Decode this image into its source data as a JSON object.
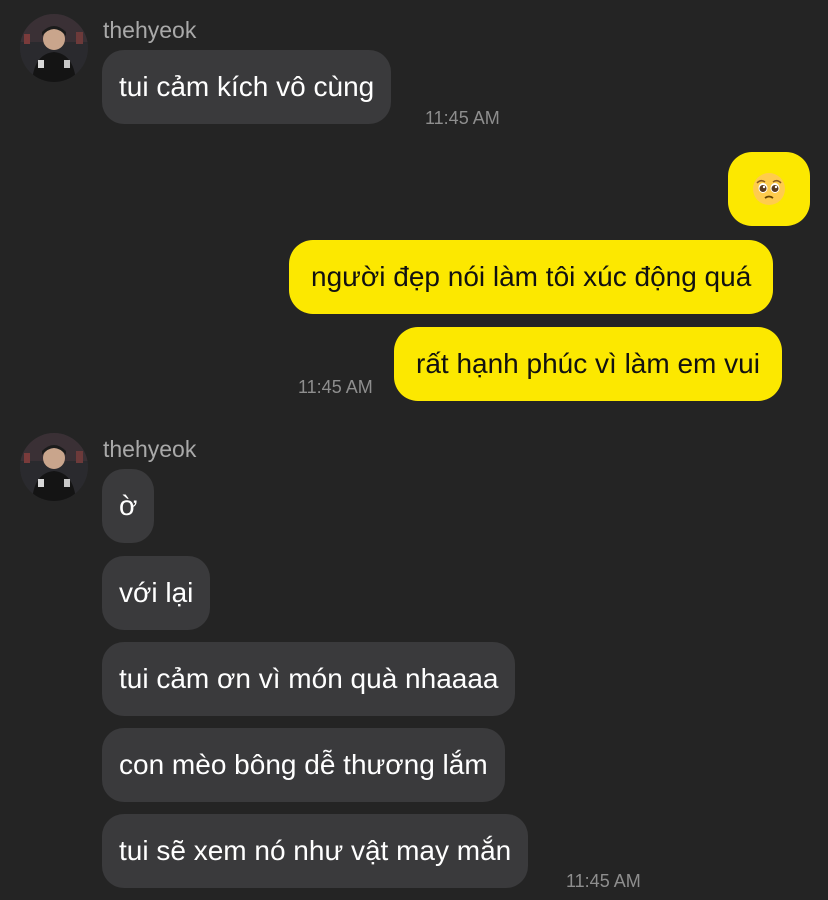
{
  "colors": {
    "background": "#242424",
    "incoming_bubble": "#3a3a3c",
    "outgoing_bubble": "#fce800",
    "timestamp": "#8e8e8e",
    "username": "#a9a9a9"
  },
  "chat": {
    "groups": [
      {
        "sender": "thehyeok",
        "avatar_icon": "profile-photo",
        "messages": [
          "tui cảm kích vô cùng"
        ],
        "time": "11:45 AM"
      },
      {
        "sender": "me",
        "messages": [
          "pleading-face-emoji",
          "người đẹp nói làm tôi xúc động quá",
          "rất hạnh phúc vì làm em vui"
        ],
        "time": "11:45 AM"
      },
      {
        "sender": "thehyeok",
        "avatar_icon": "profile-photo",
        "messages": [
          "ờ",
          "với lại",
          "tui cảm ơn vì món quà nhaaaa",
          "con mèo bông dễ thương lắm",
          "tui sẽ xem nó như vật may mắn"
        ],
        "time": "11:45 AM"
      }
    ]
  }
}
